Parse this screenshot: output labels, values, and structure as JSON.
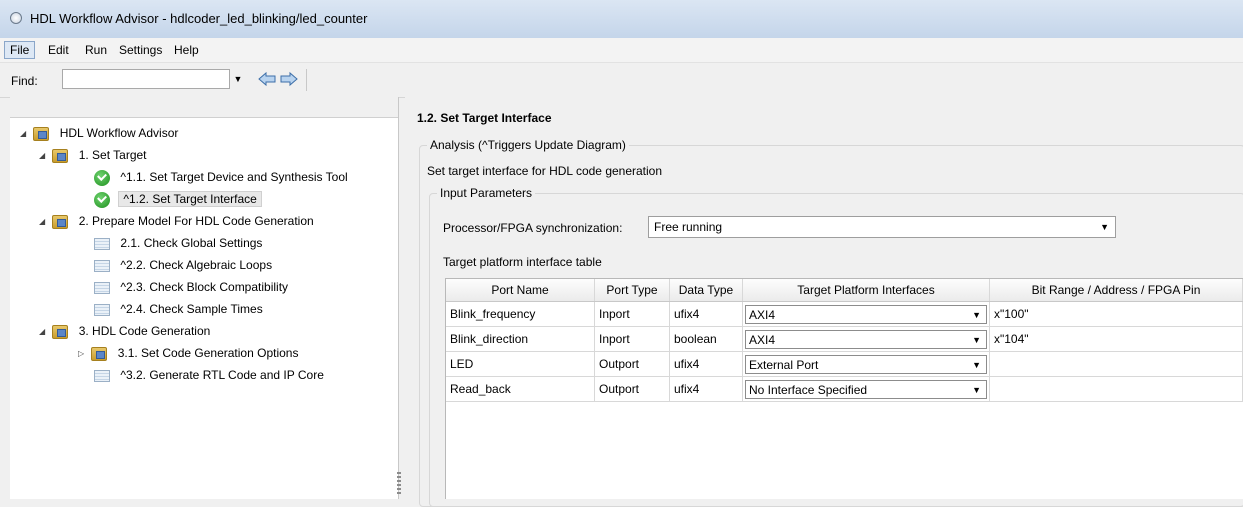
{
  "window": {
    "title": "HDL Workflow Advisor - hdlcoder_led_blinking/led_counter"
  },
  "menu": {
    "items": [
      "File",
      "Edit",
      "Run",
      "Settings",
      "Help"
    ]
  },
  "toolbar": {
    "find_label": "Find:",
    "find_value": ""
  },
  "tree": {
    "root": "HDL Workflow Advisor",
    "set_target": "1. Set Target",
    "set_target_device": "^1.1. Set Target Device and Synthesis Tool",
    "set_target_interface": "^1.2. Set Target Interface",
    "prepare_model": "2. Prepare Model For HDL Code Generation",
    "check_global": "2.1. Check Global Settings",
    "check_algebraic": "^2.2. Check Algebraic Loops",
    "check_block": "^2.3. Check Block Compatibility",
    "check_sample": "^2.4. Check Sample Times",
    "hdl_codegen": "3. HDL Code Generation",
    "set_codegen_options": "3.1. Set Code Generation Options",
    "generate_rtl": "^3.2. Generate RTL Code and IP Core"
  },
  "main": {
    "heading": "1.2. Set Target Interface",
    "analysis_legend": "Analysis (^Triggers Update Diagram)",
    "description": "Set target interface for HDL code generation",
    "input_params_legend": "Input Parameters",
    "sync_label": "Processor/FPGA synchronization:",
    "sync_value": "Free running",
    "table_title": "Target platform interface table",
    "table": {
      "headers": [
        "Port Name",
        "Port Type",
        "Data Type",
        "Target Platform Interfaces",
        "Bit Range / Address / FPGA Pin"
      ],
      "rows": [
        {
          "port": "Blink_frequency",
          "type": "Inport",
          "dtype": "ufix4",
          "interface": "AXI4",
          "bits": "x\"100\""
        },
        {
          "port": "Blink_direction",
          "type": "Inport",
          "dtype": "boolean",
          "interface": "AXI4",
          "bits": "x\"104\""
        },
        {
          "port": "LED",
          "type": "Outport",
          "dtype": "ufix4",
          "interface": "External Port",
          "bits": ""
        },
        {
          "port": "Read_back",
          "type": "Outport",
          "dtype": "ufix4",
          "interface": "No Interface Specified",
          "bits": ""
        }
      ]
    }
  }
}
